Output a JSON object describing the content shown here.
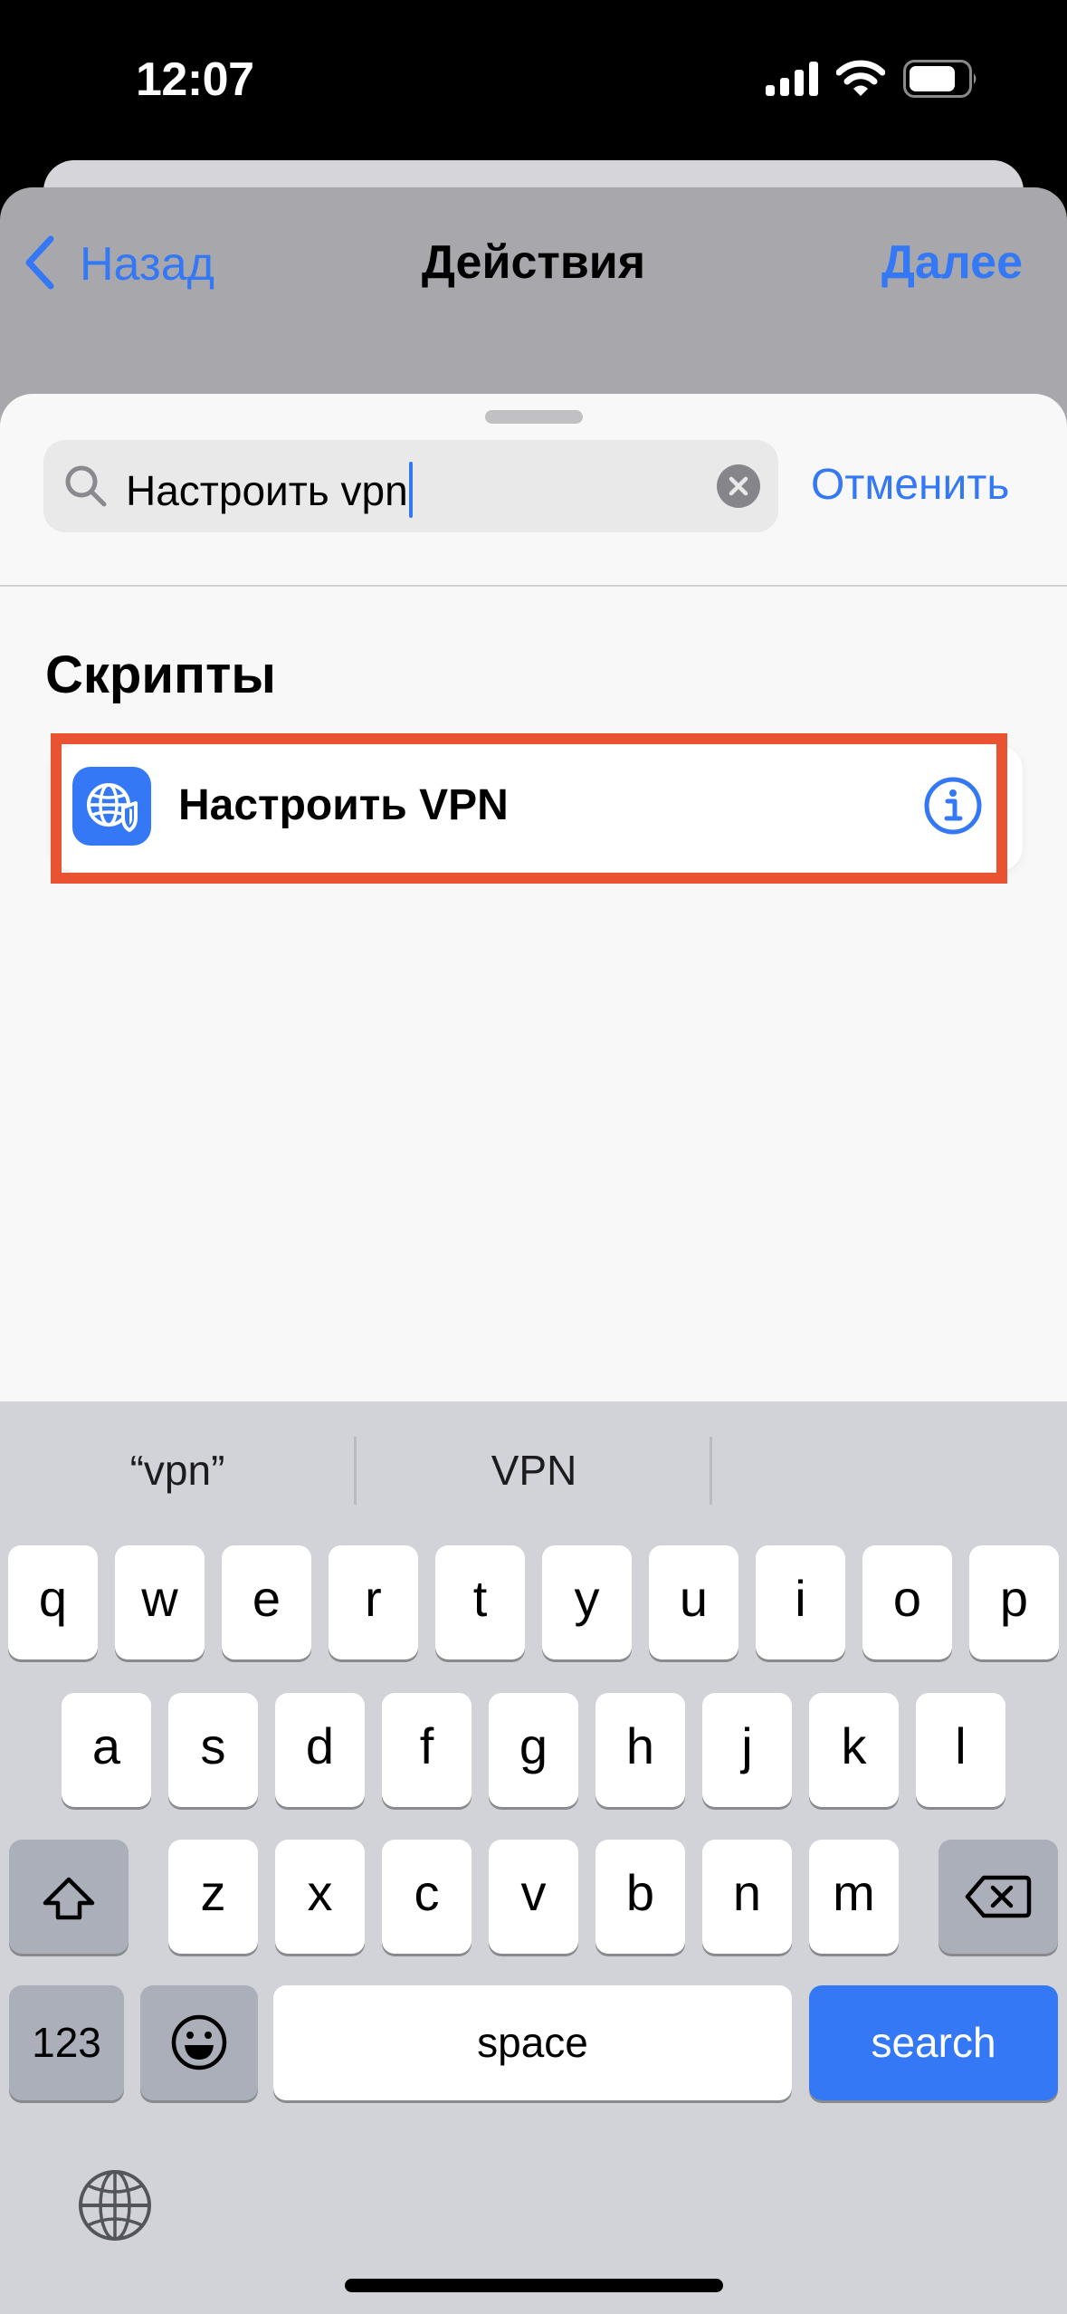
{
  "status_bar": {
    "time": "12:07",
    "icons": [
      "cellular-signal-icon",
      "wifi-icon",
      "battery-icon"
    ],
    "battery_level": 0.8
  },
  "nav": {
    "back_label": "Назад",
    "title": "Действия",
    "next_label": "Далее"
  },
  "search": {
    "value": "Настроить vpn",
    "clear_icon": "clear-circle-icon",
    "search_icon": "magnifying-glass-icon",
    "cancel_label": "Отменить"
  },
  "results": {
    "section_title": "Скрипты",
    "items": [
      {
        "label": "Настроить VPN",
        "icon": "globe-shield-icon",
        "accessory": "info-icon"
      }
    ]
  },
  "keyboard": {
    "suggestions": [
      "“vpn”",
      "VPN",
      ""
    ],
    "row1": [
      "q",
      "w",
      "e",
      "r",
      "t",
      "y",
      "u",
      "i",
      "o",
      "p"
    ],
    "row2": [
      "a",
      "s",
      "d",
      "f",
      "g",
      "h",
      "j",
      "k",
      "l"
    ],
    "row3": [
      "z",
      "x",
      "c",
      "v",
      "b",
      "n",
      "m"
    ],
    "numbers_label": "123",
    "space_label": "space",
    "search_label": "search"
  },
  "colors": {
    "accent": "#3478f6",
    "highlight": "#ea5331",
    "keyboard_bg": "#d1d3d9"
  }
}
